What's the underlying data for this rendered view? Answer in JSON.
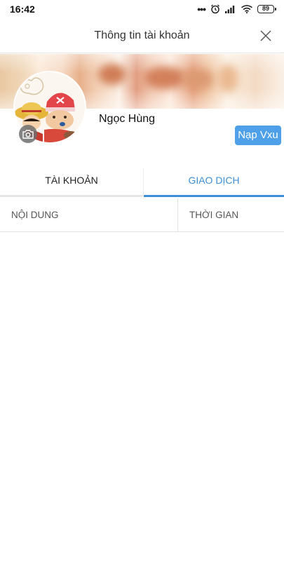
{
  "status_bar": {
    "time": "16:42",
    "battery": "89",
    "icons": [
      "more-dots-icon",
      "alarm-icon",
      "signal-icon",
      "wifi-icon",
      "battery-icon"
    ]
  },
  "header": {
    "title": "Thông tin tài khoản",
    "close_icon": "close-icon"
  },
  "profile": {
    "name": "Ngọc Hùng",
    "avatar_icon": "avatar-image",
    "camera_icon": "camera-icon",
    "topup_label": "Nạp Vxu"
  },
  "tabs": [
    {
      "label": "TÀI KHOẢN",
      "active": false
    },
    {
      "label": "GIAO DỊCH",
      "active": true
    }
  ],
  "table": {
    "columns": [
      "NỘI DUNG",
      "THỜI GIAN"
    ],
    "rows": []
  },
  "colors": {
    "accent": "#3d8fd6",
    "button": "#4ea1e9"
  }
}
